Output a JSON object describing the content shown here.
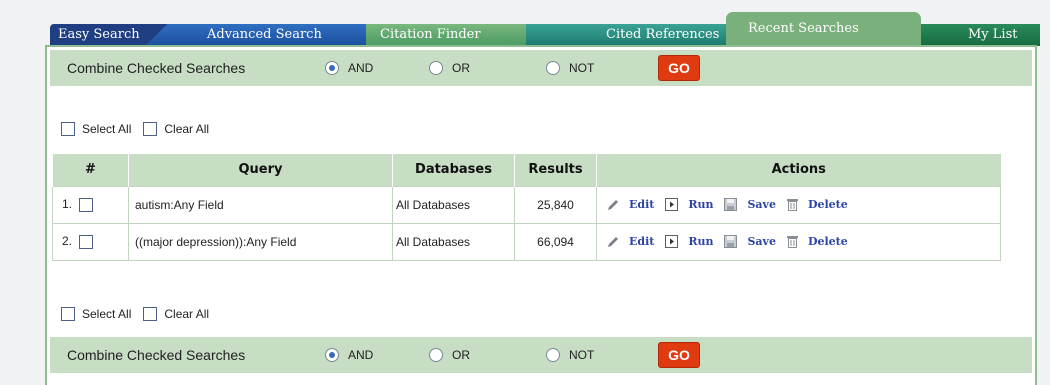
{
  "tabs": [
    {
      "label": "Easy Search"
    },
    {
      "label": "Advanced Search"
    },
    {
      "label": "Citation Finder"
    },
    {
      "label": "Cited References"
    },
    {
      "label": "Recent Searches",
      "active": true
    },
    {
      "label": "My List"
    }
  ],
  "combine": {
    "label": "Combine Checked Searches",
    "options": [
      "AND",
      "OR",
      "NOT"
    ],
    "selected": "AND",
    "go_label": "GO"
  },
  "select": {
    "select_all": "Select All",
    "clear_all": "Clear All"
  },
  "table": {
    "headers": {
      "num": "#",
      "query": "Query",
      "databases": "Databases",
      "results": "Results",
      "actions": "Actions"
    },
    "rows": [
      {
        "num": "1.",
        "query": "autism:Any Field",
        "databases": "All Databases",
        "results": "25,840"
      },
      {
        "num": "2.",
        "query": "((major depression)):Any Field",
        "databases": "All Databases",
        "results": "66,094"
      }
    ],
    "action_labels": {
      "edit": "Edit",
      "run": "Run",
      "save": "Save",
      "delete": "Delete"
    }
  },
  "colors": {
    "panel_green": "#c7ddc4",
    "go_red": "#e03a10",
    "link_blue": "#2c44a5"
  }
}
